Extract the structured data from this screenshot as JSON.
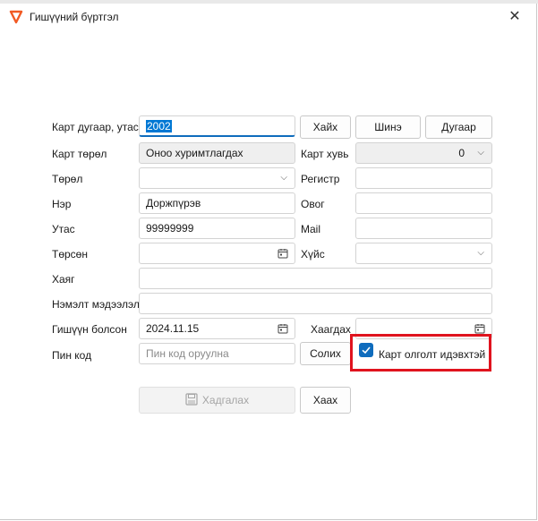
{
  "window": {
    "title": "Гишүүний бүртгэл"
  },
  "labels": {
    "card_number_phone": "Карт дугаар, утас",
    "card_type": "Карт төрөл",
    "card_share": "Карт хувь",
    "type": "Төрөл",
    "register": "Регистр",
    "name": "Нэр",
    "surname": "Овог",
    "phone": "Утас",
    "mail": "Mail",
    "birth": "Төрсөн",
    "gender": "Хүйс",
    "address": "Хаяг",
    "extra_info": "Нэмэлт мэдээлэл",
    "member_since": "Гишүүн болсон",
    "closing": "Хаагдах",
    "pin_code": "Пин код"
  },
  "fields": {
    "card_number": "2002",
    "card_type": "Оноо хуримтлагдах",
    "card_share": "0",
    "type": "",
    "register": "",
    "name": "Доржпүрэв",
    "surname": "",
    "phone": "99999999",
    "mail": "",
    "birth": "",
    "gender": "",
    "address": "",
    "extra_info": "",
    "member_since": "2024.11.15",
    "closing": "",
    "pin_code": "",
    "pin_placeholder": "Пин код оруулна"
  },
  "buttons": {
    "search": "Хайх",
    "new": "Шинэ",
    "number": "Дугаар",
    "change": "Солих",
    "save": "Хадгалах",
    "close": "Хаах"
  },
  "checkbox": {
    "label": "Карт олголт идэвхтэй",
    "checked": true
  },
  "colors": {
    "accent": "#0f6cbd",
    "highlight": "#e0131e",
    "logo": "#f15a24"
  },
  "icons": {
    "app": "app-logo-icon",
    "close": "close-icon",
    "calendar": "calendar-icon",
    "dropdown": "chevron-down-icon",
    "save": "save-icon",
    "check": "checkmark-icon"
  }
}
